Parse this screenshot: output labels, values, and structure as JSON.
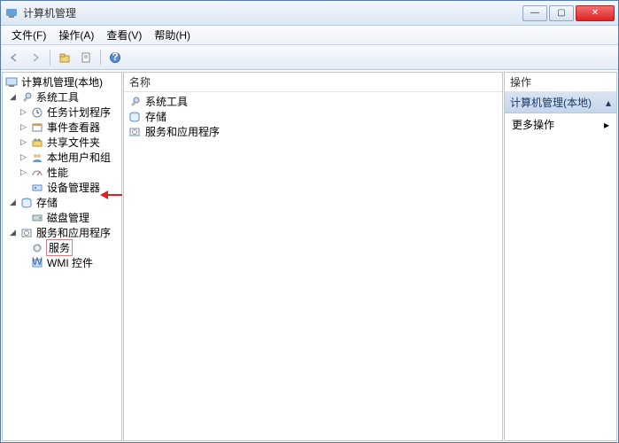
{
  "titlebar": {
    "title": "计算机管理"
  },
  "menu": {
    "file": "文件(F)",
    "action": "操作(A)",
    "view": "查看(V)",
    "help": "帮助(H)"
  },
  "tree": {
    "root": "计算机管理(本地)",
    "system_tools": "系统工具",
    "task_scheduler": "任务计划程序",
    "event_viewer": "事件查看器",
    "shared_folders": "共享文件夹",
    "local_users": "本地用户和组",
    "performance": "性能",
    "device_manager": "设备管理器",
    "storage": "存储",
    "disk_mgmt": "磁盘管理",
    "services_apps": "服务和应用程序",
    "services": "服务",
    "wmi": "WMI 控件"
  },
  "detail": {
    "column_name": "名称",
    "items": {
      "system_tools": "系统工具",
      "storage": "存储",
      "services_apps": "服务和应用程序"
    }
  },
  "actions": {
    "title": "操作",
    "section": "计算机管理(本地)",
    "more": "更多操作"
  }
}
